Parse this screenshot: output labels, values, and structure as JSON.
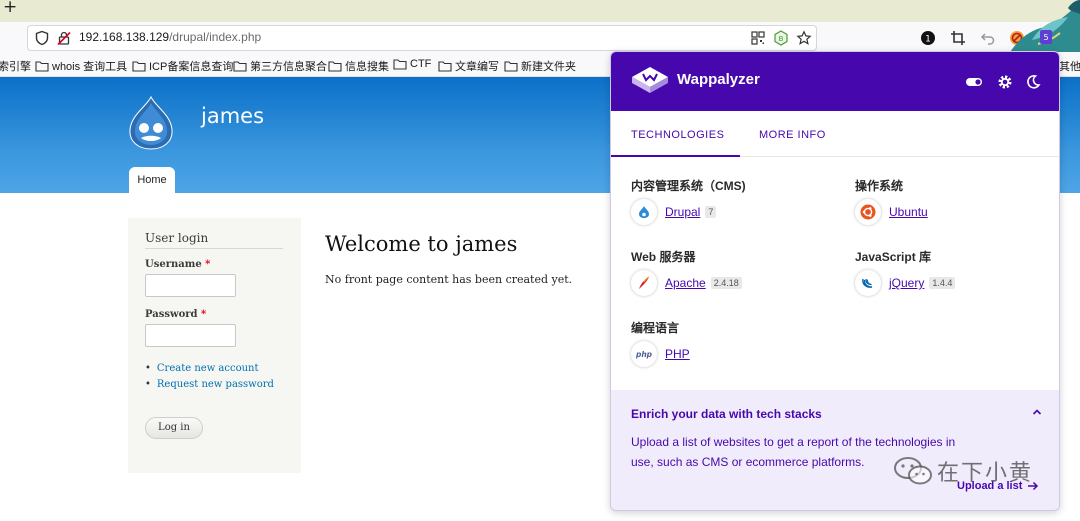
{
  "browser": {
    "url_host": "192.168.138.129",
    "url_path": "/drupal/index.php",
    "extension_badge": "5",
    "bookmarks": [
      {
        "label": "索引擎",
        "folder": false
      },
      {
        "label": "whois 查询工具",
        "folder": true
      },
      {
        "label": "ICP备案信息查询",
        "folder": true
      },
      {
        "label": "第三方信息聚合",
        "folder": true
      },
      {
        "label": "信息搜集",
        "folder": true
      },
      {
        "label": "CTF",
        "folder": true
      },
      {
        "label": "文章编写",
        "folder": true
      },
      {
        "label": "新建文件夹",
        "folder": true
      }
    ],
    "bookmarks_overflow": "其他"
  },
  "site": {
    "name": "james",
    "home_tab": "Home",
    "login": {
      "title": "User login",
      "username_label": "Username",
      "password_label": "Password",
      "required_mark": "*",
      "links": [
        "Create new account",
        "Request new password"
      ],
      "button": "Log in"
    },
    "welcome_title": "Welcome to james",
    "welcome_text": "No front page content has been created yet."
  },
  "wappalyzer": {
    "title": "Wappalyzer",
    "tabs": [
      "TECHNOLOGIES",
      "MORE INFO"
    ],
    "categories": [
      {
        "name": "内容管理系统（CMS)",
        "tech": "Drupal",
        "version": "7",
        "icon": "drupal-icon"
      },
      {
        "name": "操作系统",
        "tech": "Ubuntu",
        "version": "",
        "icon": "ubuntu-icon"
      },
      {
        "name": "Web 服务器",
        "tech": "Apache",
        "version": "2.4.18",
        "icon": "apache-feather-icon"
      },
      {
        "name": "JavaScript 库",
        "tech": "jQuery",
        "version": "1.4.4",
        "icon": "jquery-icon"
      },
      {
        "name": "编程语言",
        "tech": "PHP",
        "version": "",
        "icon": "php-icon"
      }
    ],
    "enrich": {
      "title": "Enrich your data with tech stacks",
      "text": "Upload a list of websites to get a report of the technologies in use, such as CMS or ecommerce platforms.",
      "upload": "Upload a list"
    },
    "colors": {
      "brand": "#4608ad",
      "enrich_bg": "#f1ecfb"
    }
  },
  "watermark": "在下小黄"
}
